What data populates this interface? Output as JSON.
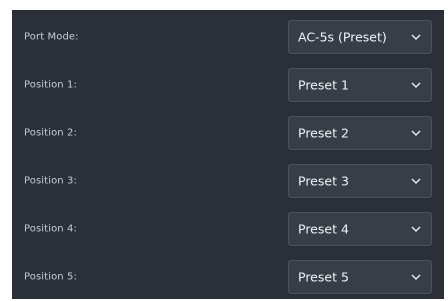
{
  "port_mode": {
    "label": "Port Mode:",
    "value": "AC-5s (Preset)",
    "icon": "chevron-down-icon"
  },
  "positions": [
    {
      "label": "Position 1:",
      "value": "Preset 1",
      "icon": "chevron-down-icon"
    },
    {
      "label": "Position 2:",
      "value": "Preset 2",
      "icon": "chevron-down-icon"
    },
    {
      "label": "Position 3:",
      "value": "Preset 3",
      "icon": "chevron-down-icon"
    },
    {
      "label": "Position 4:",
      "value": "Preset 4",
      "icon": "chevron-down-icon"
    },
    {
      "label": "Position 5:",
      "value": "Preset 5",
      "icon": "chevron-down-icon"
    }
  ],
  "colors": {
    "panel_bg": "#2a2f38",
    "select_bg": "#383e48",
    "label_text": "#c9ccd2",
    "value_text": "#f2f3f5"
  }
}
